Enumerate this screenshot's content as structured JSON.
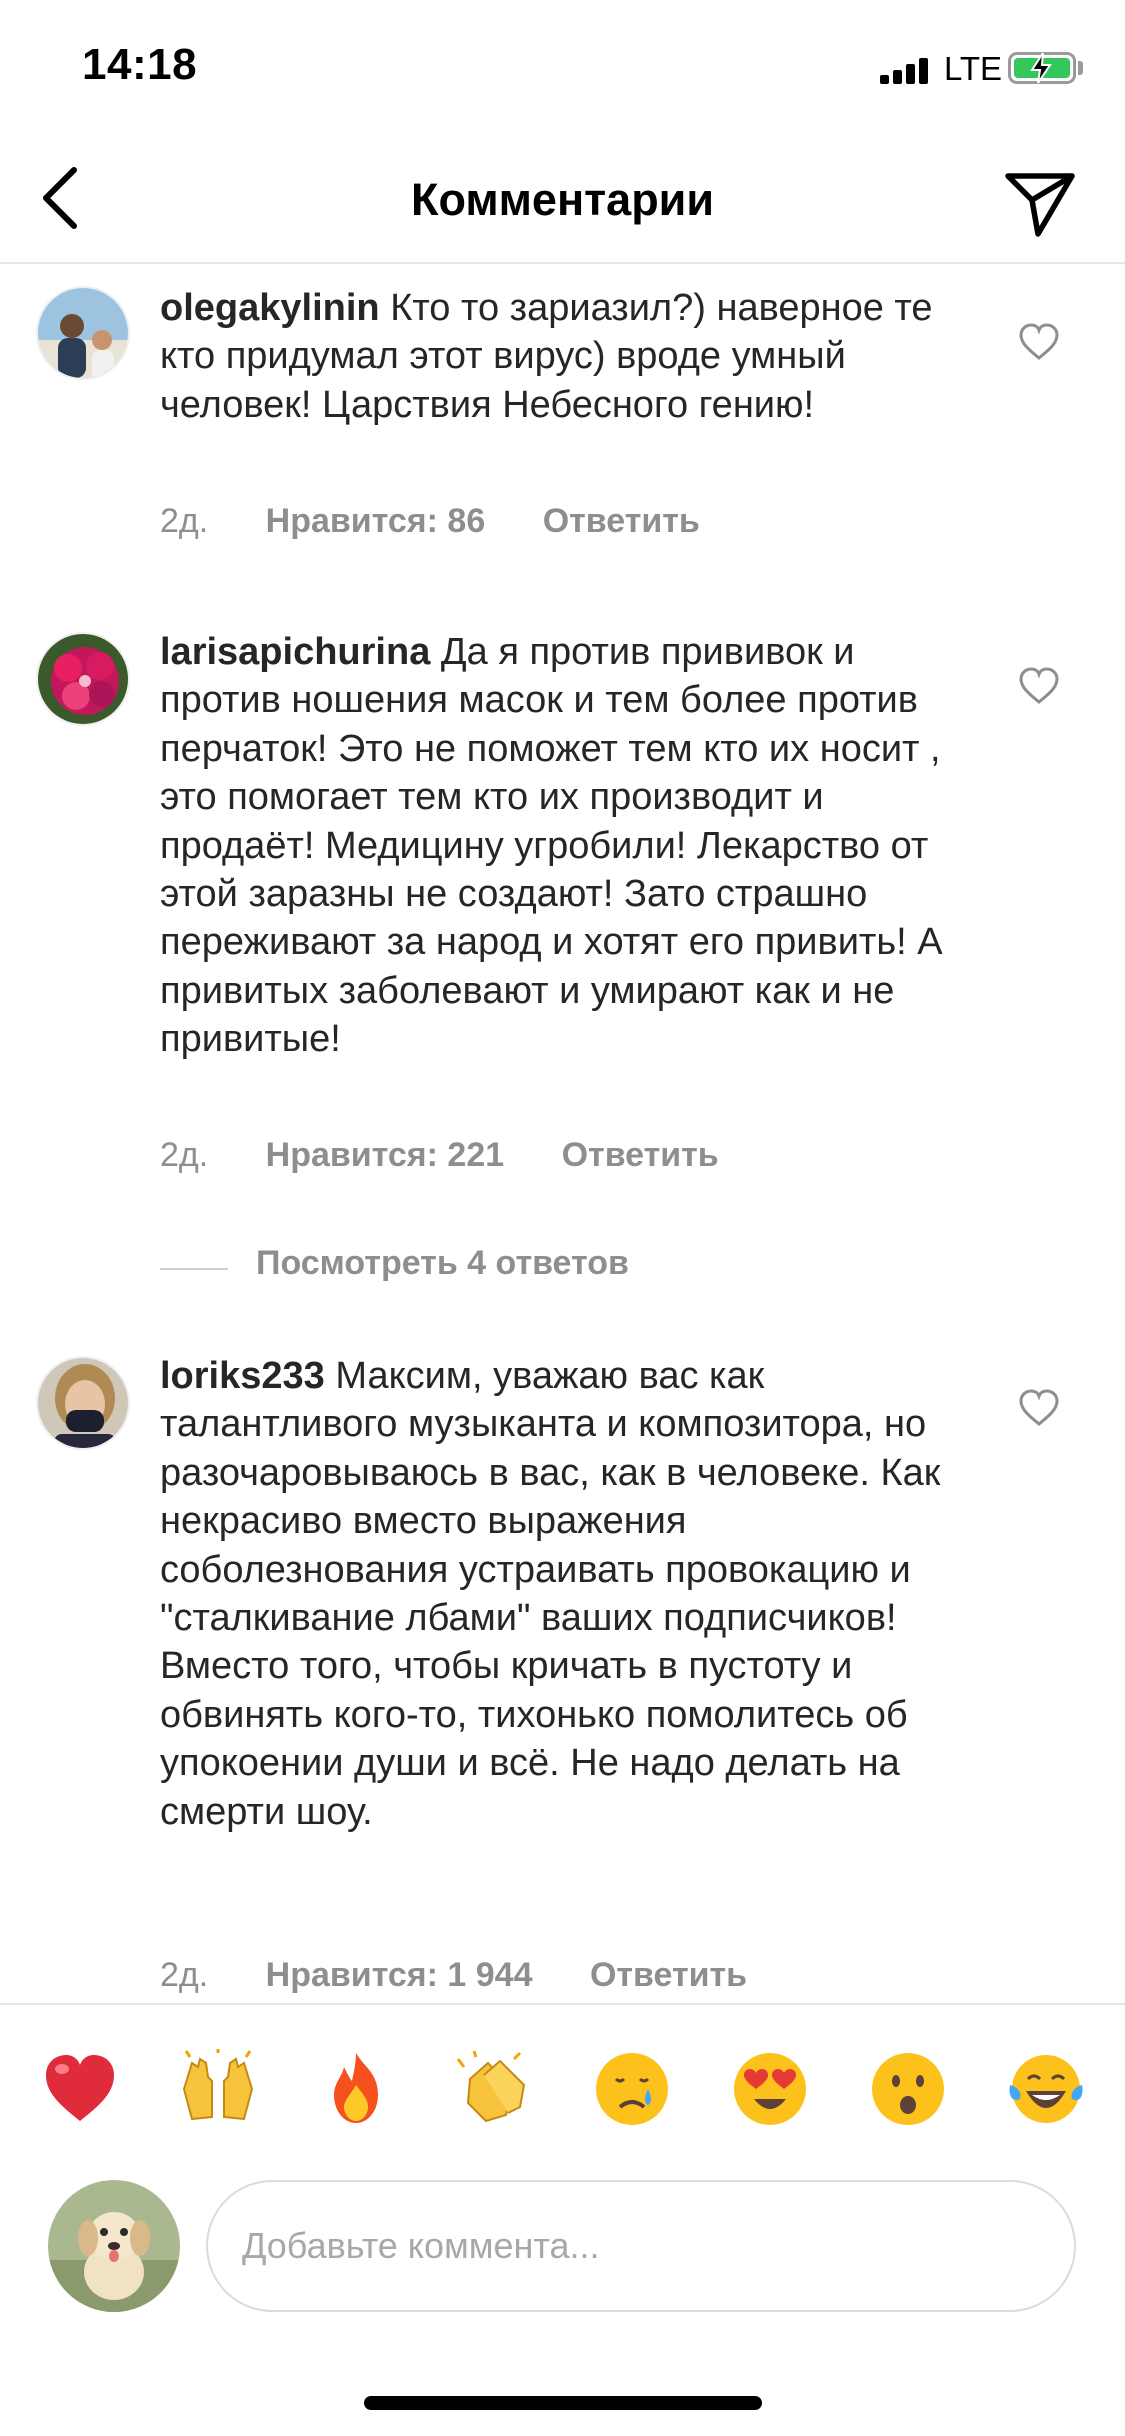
{
  "status_bar": {
    "time": "14:18",
    "network": "LTE"
  },
  "header": {
    "title": "Комментарии",
    "back_icon": "chevron-left-icon",
    "send_icon": "paper-plane-icon"
  },
  "comments": [
    {
      "username": "olegakylinin",
      "text": "Кто то зариазил?) наверное те кто придумал этот вирус) вроде умный человек! Царствия Небесного гению!",
      "time": "2д.",
      "likes": "Нравится: 86",
      "reply": "Ответить"
    },
    {
      "username": "larisapichurina",
      "text": "Да я против прививок и против ношения масок и тем более против перчаток! Это не поможет тем кто их носит , это помогает тем кто их производит и продаёт! Медицину угробили! Лекарство от этой заразны не создают! Зато страшно переживают за народ и хотят его привить! А привитых заболевают и умирают как и не привитые!",
      "time": "2д.",
      "likes": "Нравится: 221",
      "reply": "Ответить",
      "view_replies": "Посмотреть 4 ответов"
    },
    {
      "username": "loriks233",
      "text": "Максим, уважаю вас как талантливого музыканта и композитора, но разочаровываюсь в вас, как в человеке. Как некрасиво вместо выражения соболезнования устраивать провокацию и \"сталкивание лбами\" ваших подписчиков! Вместо того, чтобы кричать в пустоту и  обвинять кого-то, тихонько помолитесь об упокоении души и всё. Не надо делать на смерти шоу.",
      "time": "2д.",
      "likes": "Нравится: 1 944",
      "reply": "Ответить"
    }
  ],
  "emoji_bar": [
    "❤️",
    "🙌",
    "🔥",
    "👏",
    "😢",
    "😍",
    "😮",
    "😂"
  ],
  "input": {
    "placeholder": "Добавьте коммента..."
  },
  "colors": {
    "text": "#262626",
    "secondary": "#8e8e8e",
    "divider": "#e6e6e6",
    "battery": "#34c759"
  }
}
